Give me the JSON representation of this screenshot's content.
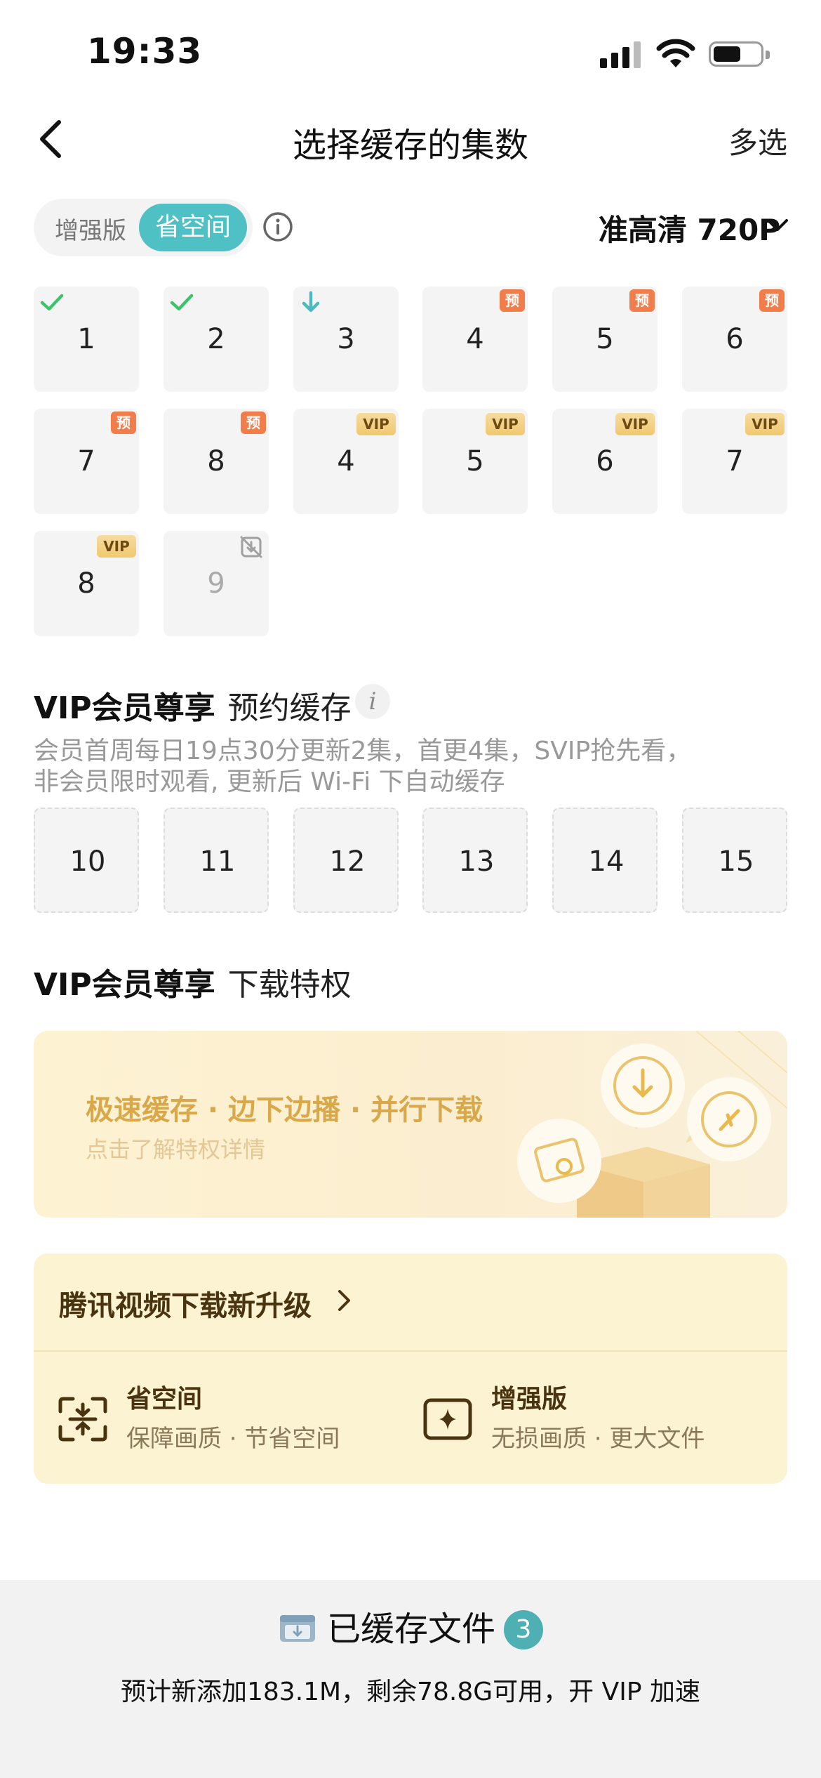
{
  "status_bar": {
    "time": "19:33"
  },
  "nav": {
    "title": "选择缓存的集数",
    "multi_select": "多选"
  },
  "quality_bar": {
    "segments": [
      "增强版",
      "省空间"
    ],
    "selected_segment": "省空间",
    "resolution": "准高清 720P"
  },
  "episodes": [
    {
      "num": "1",
      "state": "downloaded"
    },
    {
      "num": "2",
      "state": "downloaded"
    },
    {
      "num": "3",
      "state": "downloading"
    },
    {
      "num": "4",
      "badge": "预"
    },
    {
      "num": "5",
      "badge": "预"
    },
    {
      "num": "6",
      "badge": "预"
    },
    {
      "num": "7",
      "badge": "预"
    },
    {
      "num": "8",
      "badge": "预"
    },
    {
      "num": "4",
      "badge": "VIP"
    },
    {
      "num": "5",
      "badge": "VIP"
    },
    {
      "num": "6",
      "badge": "VIP"
    },
    {
      "num": "7",
      "badge": "VIP"
    },
    {
      "num": "8",
      "badge": "VIP"
    },
    {
      "num": "9",
      "state": "unavailable"
    }
  ],
  "reserve": {
    "title": "VIP会员尊享",
    "subtitle": "预约缓存",
    "info_glyph": "i",
    "desc_line1": "会员首周每日19点30分更新2集，首更4集，SVIP抢先看，",
    "desc_line2": "非会员限时观看, 更新后 Wi-Fi 下自动缓存",
    "episodes": [
      "10",
      "11",
      "12",
      "13",
      "14",
      "15"
    ]
  },
  "privilege": {
    "title": "VIP会员尊享",
    "subtitle": "下载特权",
    "promo_title": "极速缓存 · 边下边播 · 并行下载",
    "promo_sub": "点击了解特权详情"
  },
  "upgrade": {
    "heading": "腾讯视频下载新升级",
    "features": [
      {
        "name": "省空间",
        "desc": "保障画质 · 节省空间",
        "icon": "compress-icon"
      },
      {
        "name": "增强版",
        "desc": "无损画质 · 更大文件",
        "icon": "enhance-icon"
      }
    ]
  },
  "bottom": {
    "cached_label": "已缓存文件",
    "cached_count": "3",
    "note": "预计新添加183.1M，剩余78.8G可用，开 VIP 加速"
  },
  "colors": {
    "accent": "#4fc0c4",
    "vip_gold": "#f0c86e",
    "yu_orange": "#f07d4a",
    "check_green": "#3cc46a"
  }
}
